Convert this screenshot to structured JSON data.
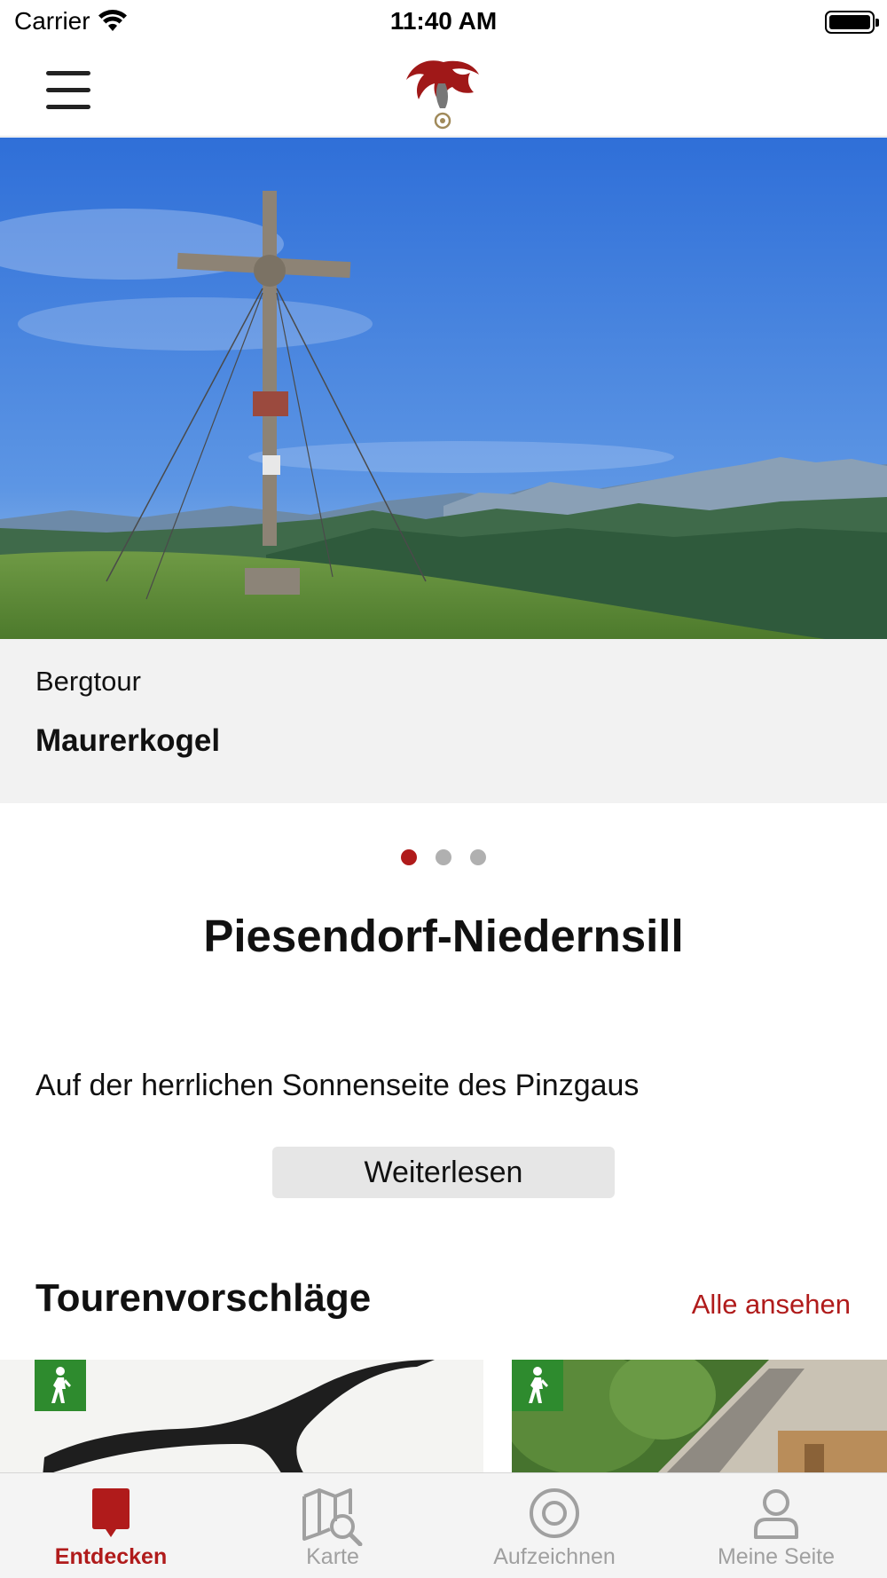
{
  "status_bar": {
    "carrier": "Carrier",
    "time": "11:40 AM"
  },
  "nav": {
    "menu_icon": "hamburger-menu-icon",
    "logo": "red-haired-figure-logo"
  },
  "hero": {
    "category": "Bergtour",
    "title": "Maurerkogel",
    "image": "summit-cross-mountain-photo"
  },
  "pager": {
    "count": 3,
    "active_index": 0
  },
  "region": {
    "title": "Piesendorf-Niedernsill",
    "intro": "Auf der herrlichen Sonnenseite des Pinzgaus",
    "read_more_label": "Weiterlesen"
  },
  "tours": {
    "header": "Tourenvorschläge",
    "see_all_label": "Alle ansehen",
    "cards": [
      {
        "badge_icon": "hiker-icon",
        "image": "dark-branch-photo"
      },
      {
        "badge_icon": "hiker-icon",
        "image": "wooden-chapel-photo"
      }
    ]
  },
  "tab_bar": {
    "tabs": [
      {
        "label": "Entdecken",
        "icon": "discover-icon",
        "active": true
      },
      {
        "label": "Karte",
        "icon": "map-search-icon",
        "active": false
      },
      {
        "label": "Aufzeichnen",
        "icon": "record-icon",
        "active": false
      },
      {
        "label": "Meine Seite",
        "icon": "person-icon",
        "active": false
      }
    ]
  },
  "colors": {
    "accent": "#b01b1b",
    "badge_green": "#2e8b2e",
    "caption_bg": "#f2f2f2"
  }
}
